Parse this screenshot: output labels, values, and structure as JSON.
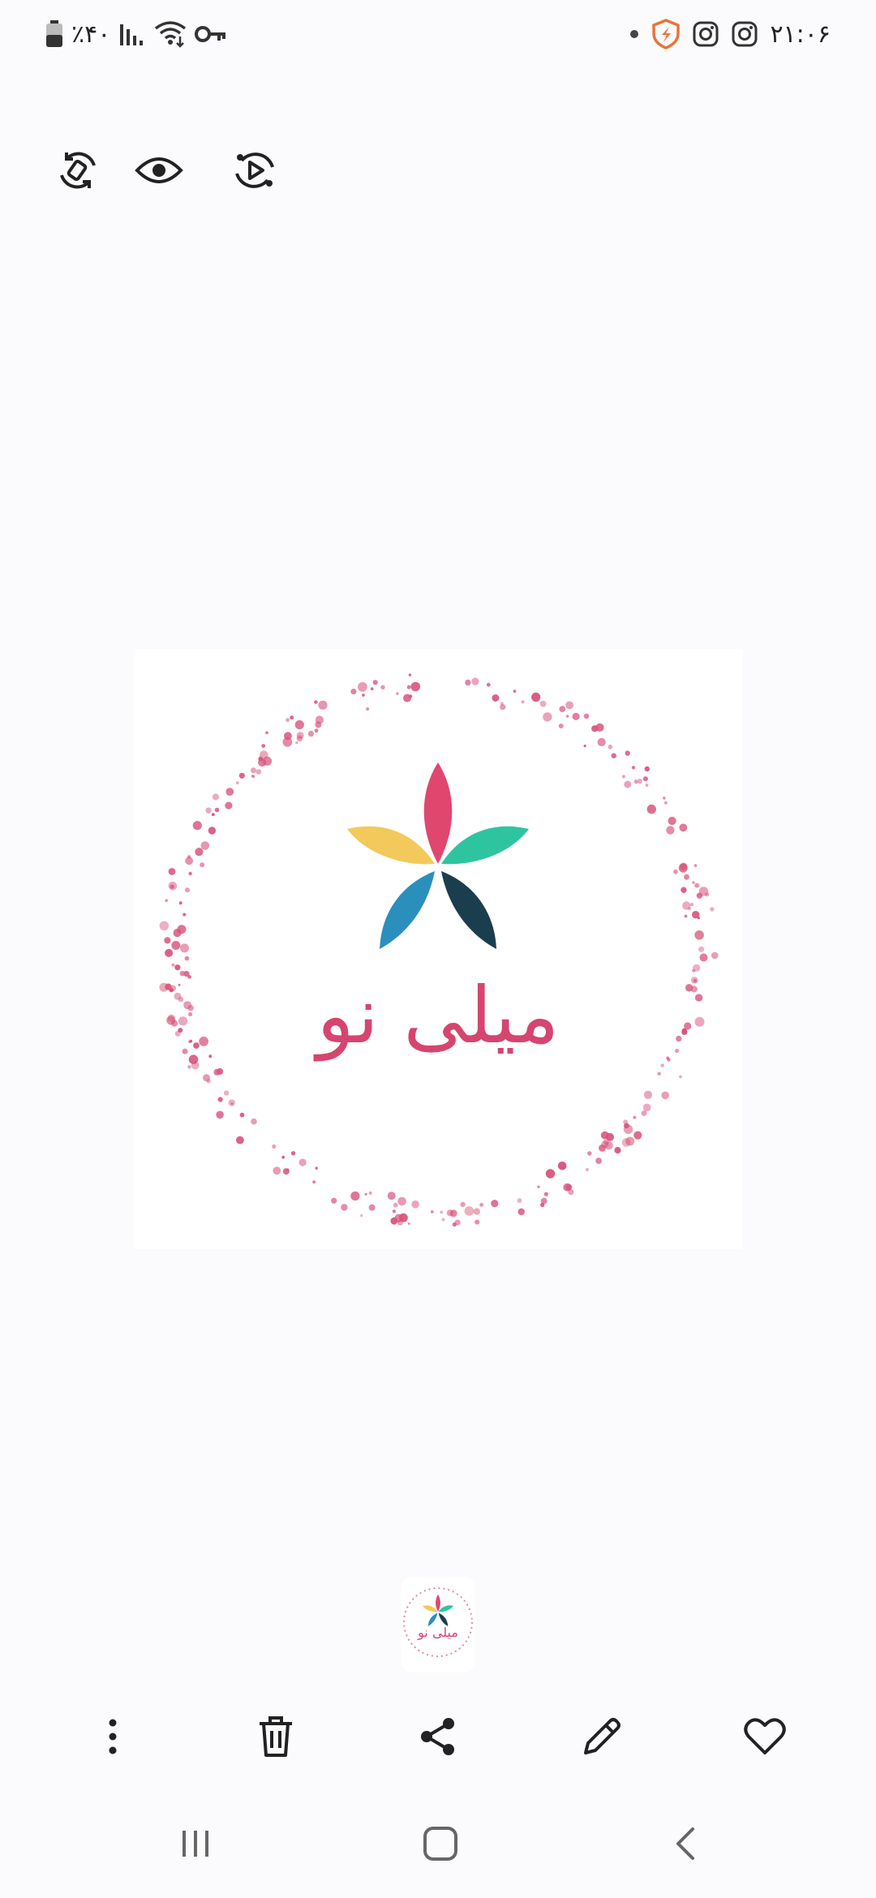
{
  "status_bar": {
    "battery_text": "٪۴۰",
    "time": "۲۱:۰۶",
    "icons": [
      "battery-icon",
      "signal-icon",
      "wifi-icon",
      "vpn-key-icon",
      "dot-icon",
      "shield-app-icon",
      "instagram-icon",
      "instagram-icon"
    ]
  },
  "top_actions": [
    {
      "name": "rotate-button",
      "icon": "rotate-icon"
    },
    {
      "name": "view-button",
      "icon": "eye-icon"
    },
    {
      "name": "motion-photo-button",
      "icon": "play-circle-icon"
    }
  ],
  "image": {
    "logo_text": "میلی نو",
    "colors": {
      "dots": "#d8527a",
      "petal_pink": "#e0476f",
      "petal_yellow": "#f4c95b",
      "petal_green": "#2fc4a0",
      "petal_blue": "#2b8fbd",
      "petal_dark": "#1b3e4f",
      "text": "#d6456f"
    }
  },
  "thumbnail": {
    "logo_text": "میلی نو"
  },
  "bottom_toolbar": [
    {
      "name": "more-options-button",
      "icon": "more-vertical-icon"
    },
    {
      "name": "delete-button",
      "icon": "trash-icon"
    },
    {
      "name": "share-button",
      "icon": "share-icon"
    },
    {
      "name": "edit-button",
      "icon": "pencil-icon"
    },
    {
      "name": "favorite-button",
      "icon": "heart-icon"
    }
  ],
  "nav_bar": [
    {
      "name": "recent-apps-button",
      "icon": "recents-icon"
    },
    {
      "name": "home-button",
      "icon": "home-icon"
    },
    {
      "name": "back-button",
      "icon": "back-icon"
    }
  ]
}
